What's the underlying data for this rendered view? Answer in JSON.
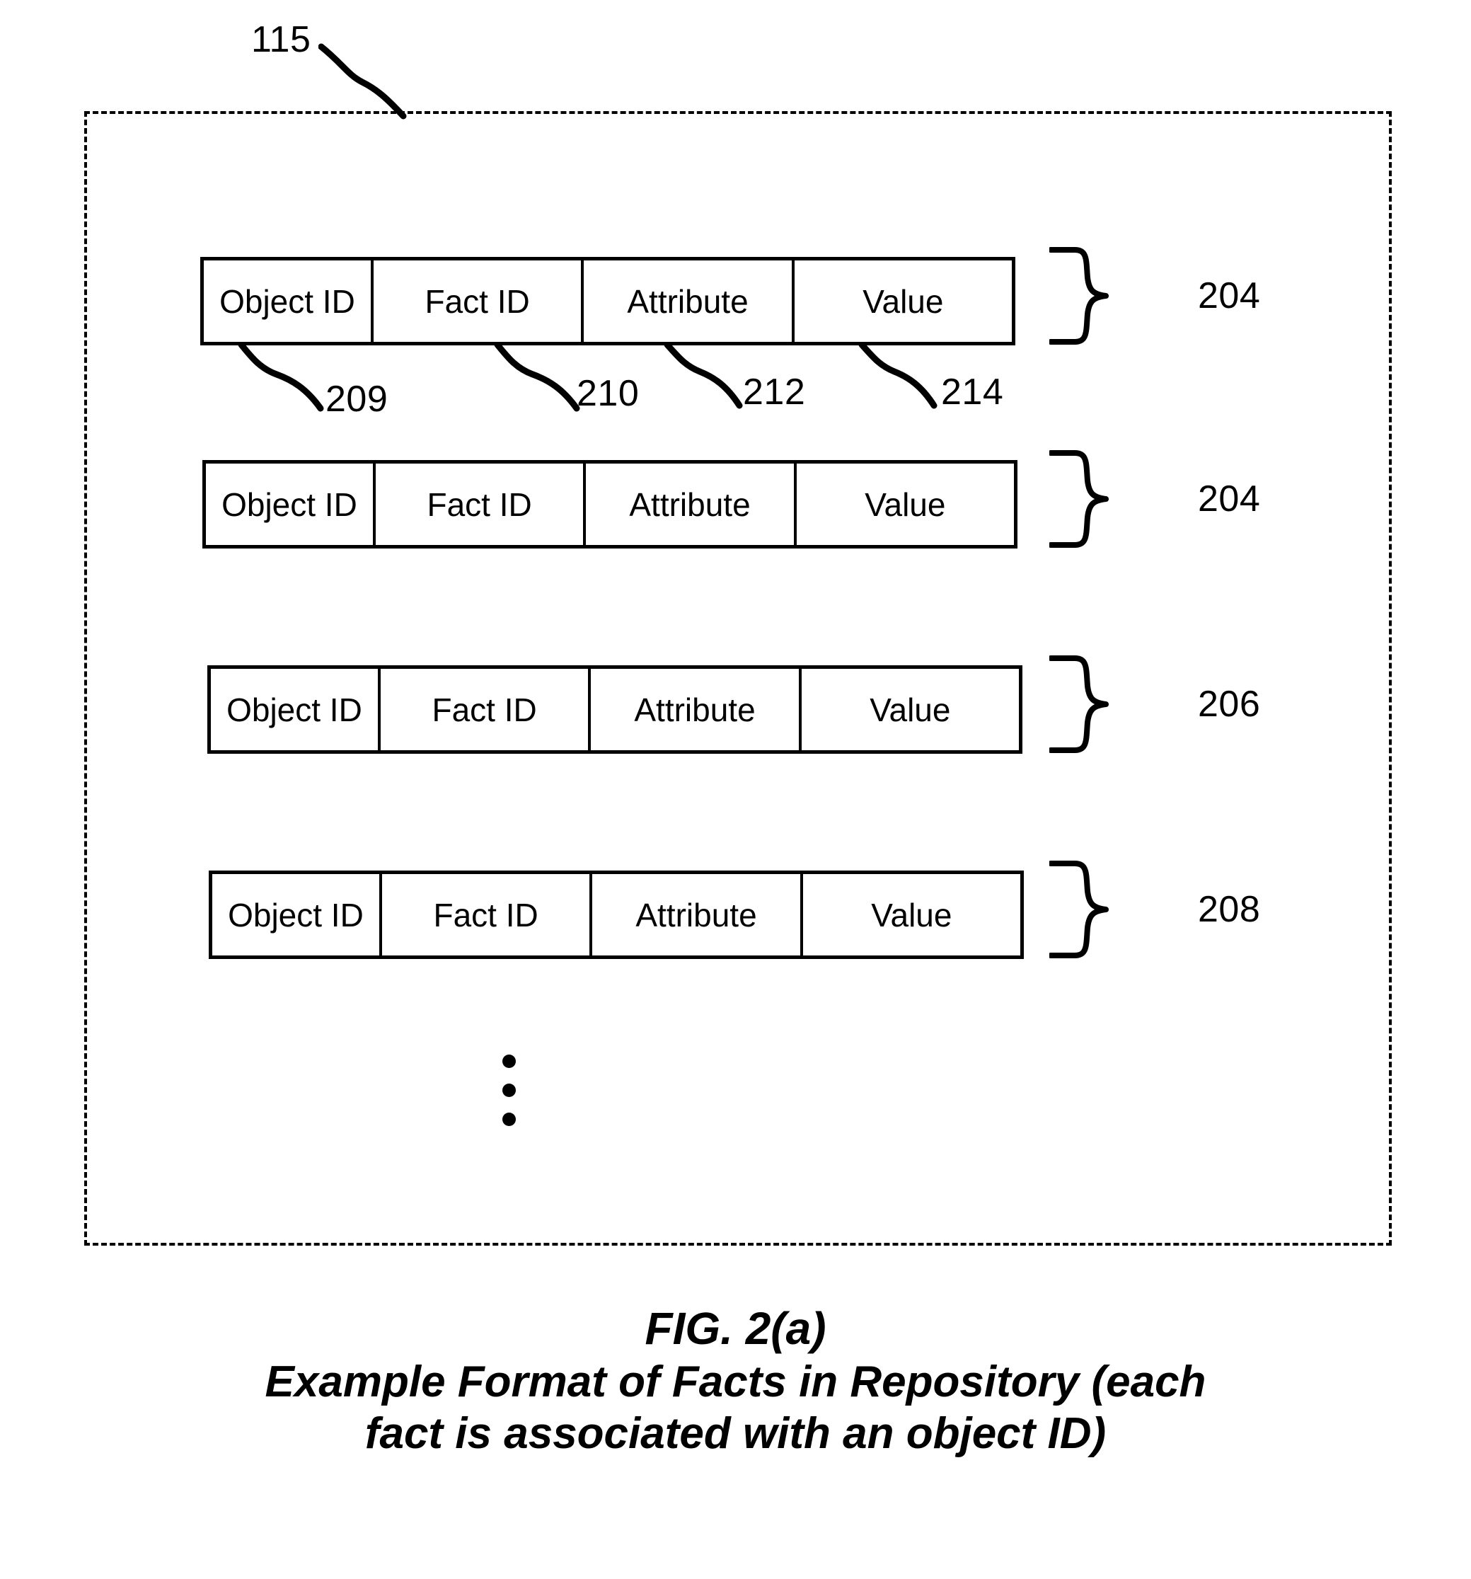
{
  "figure": {
    "reference_numeral": "115",
    "caption_title": "FIG. 2(a)",
    "caption_line1": "Example Format of Facts in Repository (each",
    "caption_line2": "fact is associated with an object ID)"
  },
  "columns": {
    "object_id": "Object ID",
    "fact_id": "Fact ID",
    "attribute": "Attribute",
    "value": "Value"
  },
  "column_callouts": [
    {
      "ref": "209",
      "target": "Object ID"
    },
    {
      "ref": "210",
      "target": "Fact ID"
    },
    {
      "ref": "212",
      "target": "Attribute"
    },
    {
      "ref": "214",
      "target": "Value"
    }
  ],
  "fact_rows": [
    {
      "group_ref": "204",
      "cells": {
        "object_id": "Object ID",
        "fact_id": "Fact ID",
        "attribute": "Attribute",
        "value": "Value"
      }
    },
    {
      "group_ref": "204",
      "cells": {
        "object_id": "Object ID",
        "fact_id": "Fact ID",
        "attribute": "Attribute",
        "value": "Value"
      }
    },
    {
      "group_ref": "206",
      "cells": {
        "object_id": "Object ID",
        "fact_id": "Fact ID",
        "attribute": "Attribute",
        "value": "Value"
      }
    },
    {
      "group_ref": "208",
      "cells": {
        "object_id": "Object ID",
        "fact_id": "Fact ID",
        "attribute": "Attribute",
        "value": "Value"
      }
    }
  ],
  "continuation": {
    "symbol": "vertical-ellipsis",
    "dot_count": 3
  },
  "colors": {
    "ink": "#000000",
    "paper": "#ffffff"
  }
}
